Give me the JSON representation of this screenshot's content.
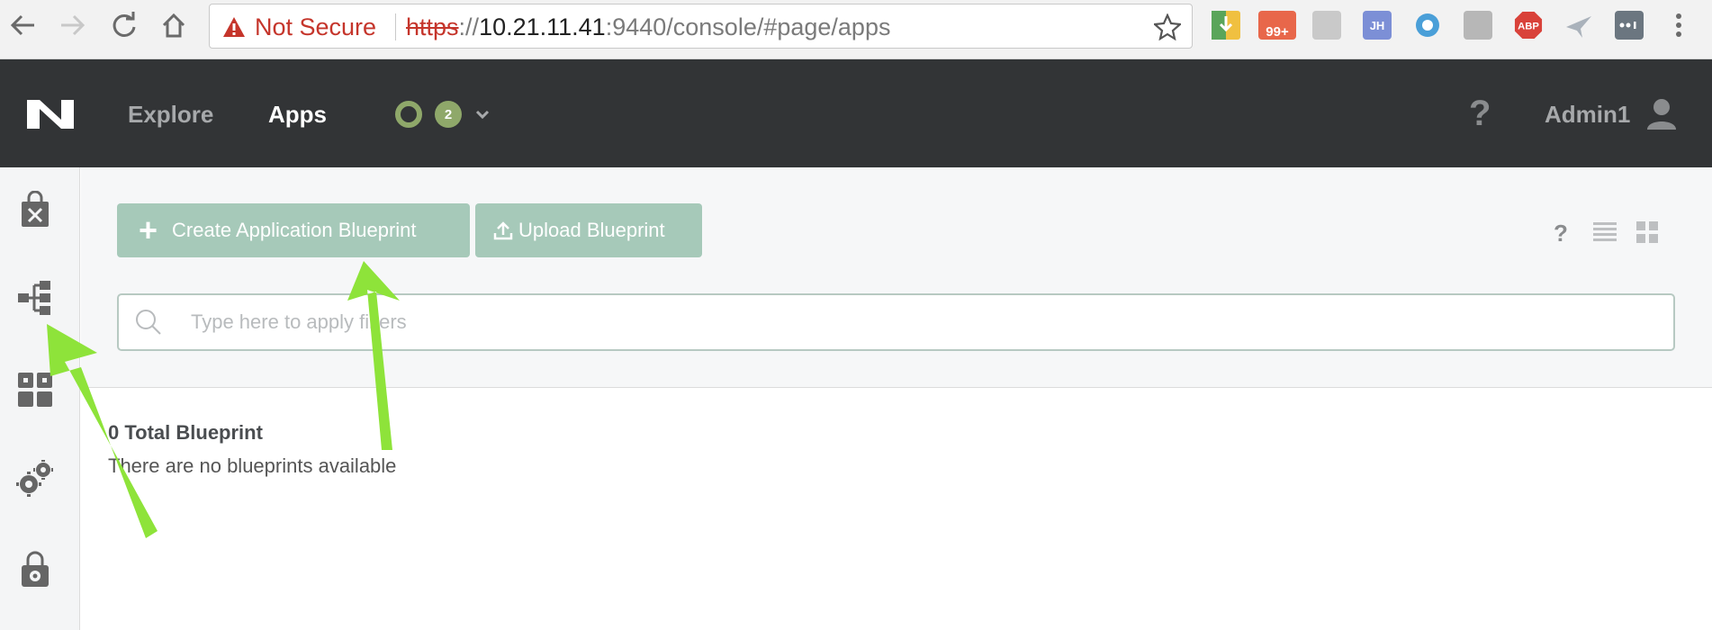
{
  "browser": {
    "security_label": "Not Secure",
    "url_scheme": "https",
    "url_sep": "://",
    "url_host": "10.21.11.41",
    "url_rest": ":9440/console/#page/apps",
    "extensions": [
      {
        "name": "download-extension",
        "label": ""
      },
      {
        "name": "badge-extension",
        "label": "99+"
      },
      {
        "name": "image-extension",
        "label": ""
      },
      {
        "name": "jh-extension",
        "label": "JH"
      },
      {
        "name": "circle-extension",
        "label": ""
      },
      {
        "name": "grey-extension",
        "label": ""
      },
      {
        "name": "adblock-extension",
        "label": "ABP"
      },
      {
        "name": "bird-extension",
        "label": ""
      },
      {
        "name": "password-extension",
        "label": ""
      }
    ]
  },
  "header": {
    "nav": [
      {
        "label": "Explore",
        "active": false
      },
      {
        "label": "Apps",
        "active": true
      }
    ],
    "alert_count": "2",
    "help_label": "?",
    "user_name": "Admin1"
  },
  "sidebar": {
    "items": [
      {
        "icon": "marketplace-bag-icon"
      },
      {
        "icon": "blueprint-tree-icon"
      },
      {
        "icon": "applications-grid-icon"
      },
      {
        "icon": "settings-gears-icon"
      },
      {
        "icon": "admin-lock-icon"
      }
    ]
  },
  "main": {
    "create_button": "Create Application Blueprint",
    "upload_button": "Upload Blueprint",
    "view_help": "?",
    "search_placeholder": "Type here to apply filters",
    "total_label": "0 Total Blueprint",
    "empty_message": "There are no blueprints available"
  },
  "colors": {
    "header_bg": "#323436",
    "button_bg": "#a6c9b9",
    "alert_green": "#8fa86a",
    "annotation_arrow": "#8ee33a"
  }
}
